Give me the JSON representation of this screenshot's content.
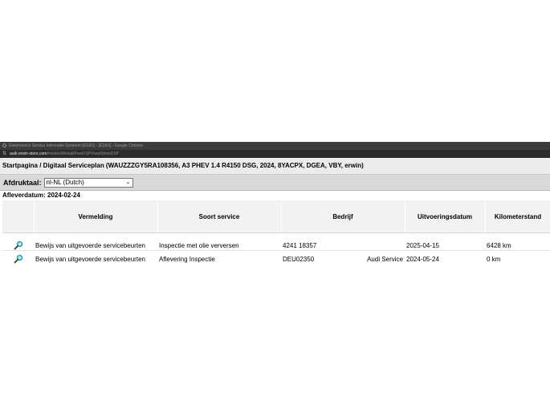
{
  "browser": {
    "title": "Elektronisch Service Informatie Systeem (ESIIS) - [ESIIS] - Google Chrome",
    "url_host": "audi.erwin-store.com",
    "url_path": "/erwin/nl/Retail/FreeDSPView/ShowDSP"
  },
  "breadcrumb": "Startpagina / Digitaal Serviceplan (WAUZZZGY5RA108356, A3 PHEV 1.4 R4150 DSG, 2024, 8YACPX, DGEA, VBY, erwin)",
  "language": {
    "label": "Afdruktaal:",
    "selected": "nl-NL (Dutch)"
  },
  "delivery_date": "Afleverdatum: 2024-02-24",
  "table": {
    "headers": [
      "",
      "Vermelding",
      "Soort service",
      "Bedrijf",
      "Uitvoeringsdatum",
      "Kilometerstand"
    ],
    "rows": [
      {
        "icon": "magnifier-icon",
        "entry": "Bewijs van uitgevoerde servicebeurten",
        "service_type": "Inspectie met olie verversen",
        "company": "4241 18357",
        "company_brand": "",
        "date": "2025-04-15",
        "mileage": "6428 km"
      },
      {
        "icon": "magnifier-icon",
        "entry": "Bewijs van uitgevoerde servicebeurten",
        "service_type": "Aflevering Inspectie",
        "company": "DEU02350",
        "company_brand": "Audi Service",
        "date": "2024-05-24",
        "mileage": "0 km"
      }
    ]
  }
}
